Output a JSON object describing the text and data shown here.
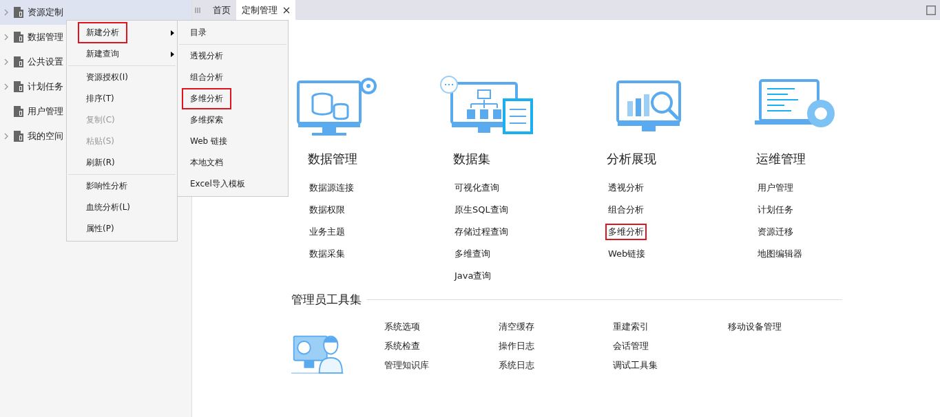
{
  "sidebar": {
    "items": [
      {
        "label": "资源定制",
        "expandable": true,
        "selected": true
      },
      {
        "label": "数据管理",
        "expandable": true,
        "selected": false
      },
      {
        "label": "公共设置",
        "expandable": true,
        "selected": false
      },
      {
        "label": "计划任务",
        "expandable": true,
        "selected": false
      },
      {
        "label": "用户管理",
        "expandable": false,
        "selected": false
      },
      {
        "label": "我的空间",
        "expandable": true,
        "selected": false
      }
    ]
  },
  "tabs": [
    {
      "label": "首页",
      "selected": false,
      "closable": false
    },
    {
      "label": "定制管理",
      "selected": true,
      "closable": true
    }
  ],
  "context_menu": {
    "items": [
      {
        "kind": "item",
        "label": "新建分析",
        "submenu": true,
        "disabled": false,
        "highlighted": true
      },
      {
        "kind": "item",
        "label": "新建查询",
        "submenu": true,
        "disabled": false,
        "highlighted": false
      },
      {
        "kind": "separator"
      },
      {
        "kind": "item",
        "label": "资源授权(I)",
        "submenu": false,
        "disabled": false,
        "highlighted": false
      },
      {
        "kind": "item",
        "label": "排序(T)",
        "submenu": false,
        "disabled": false,
        "highlighted": false
      },
      {
        "kind": "item",
        "label": "复制(C)",
        "submenu": false,
        "disabled": true,
        "highlighted": false
      },
      {
        "kind": "item",
        "label": "粘贴(S)",
        "submenu": false,
        "disabled": true,
        "highlighted": false
      },
      {
        "kind": "item",
        "label": "刷新(R)",
        "submenu": false,
        "disabled": false,
        "highlighted": false
      },
      {
        "kind": "separator"
      },
      {
        "kind": "item",
        "label": "影响性分析",
        "submenu": false,
        "disabled": false,
        "highlighted": false
      },
      {
        "kind": "item",
        "label": "血统分析(L)",
        "submenu": false,
        "disabled": false,
        "highlighted": false
      },
      {
        "kind": "item",
        "label": "属性(P)",
        "submenu": false,
        "disabled": false,
        "highlighted": false
      }
    ]
  },
  "submenu": {
    "items": [
      {
        "kind": "item",
        "label": "目录",
        "highlighted": false
      },
      {
        "kind": "separator"
      },
      {
        "kind": "item",
        "label": "透视分析",
        "highlighted": false
      },
      {
        "kind": "item",
        "label": "组合分析",
        "highlighted": false
      },
      {
        "kind": "item",
        "label": "多维分析",
        "highlighted": true
      },
      {
        "kind": "item",
        "label": "多维探索",
        "highlighted": false
      },
      {
        "kind": "item",
        "label": "Web 链接",
        "highlighted": false
      },
      {
        "kind": "item",
        "label": "本地文档",
        "highlighted": false
      },
      {
        "kind": "item",
        "label": "Excel导入模板",
        "highlighted": false
      }
    ]
  },
  "categories": [
    {
      "title": "数据管理",
      "links": [
        {
          "label": "数据源连接",
          "highlighted": false
        },
        {
          "label": "数据权限",
          "highlighted": false
        },
        {
          "label": "业务主题",
          "highlighted": false
        },
        {
          "label": "数据采集",
          "highlighted": false
        }
      ]
    },
    {
      "title": "数据集",
      "links": [
        {
          "label": "可视化查询",
          "highlighted": false
        },
        {
          "label": "原生SQL查询",
          "highlighted": false
        },
        {
          "label": "存储过程查询",
          "highlighted": false
        },
        {
          "label": "多维查询",
          "highlighted": false
        },
        {
          "label": "Java查询",
          "highlighted": false
        }
      ]
    },
    {
      "title": "分析展现",
      "links": [
        {
          "label": "透视分析",
          "highlighted": false
        },
        {
          "label": "组合分析",
          "highlighted": false
        },
        {
          "label": "多维分析",
          "highlighted": true
        },
        {
          "label": "Web链接",
          "highlighted": false
        }
      ]
    },
    {
      "title": "运维管理",
      "links": [
        {
          "label": "用户管理",
          "highlighted": false
        },
        {
          "label": "计划任务",
          "highlighted": false
        },
        {
          "label": "资源迁移",
          "highlighted": false
        },
        {
          "label": "地图编辑器",
          "highlighted": false
        }
      ]
    }
  ],
  "admin_tools": {
    "title": "管理员工具集",
    "columns": [
      [
        "系统选项",
        "系统检查",
        "管理知识库"
      ],
      [
        "清空缓存",
        "操作日志",
        "系统日志"
      ],
      [
        "重建索引",
        "会话管理",
        "调试工具集"
      ],
      [
        "移动设备管理"
      ]
    ]
  }
}
